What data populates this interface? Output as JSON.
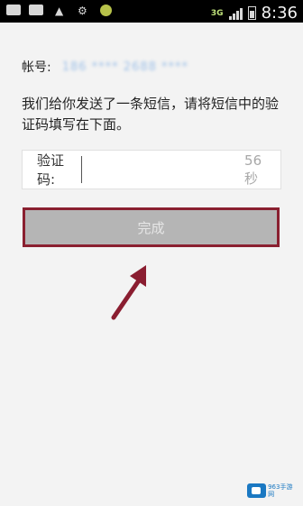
{
  "status_bar": {
    "time": "8:36",
    "network": "3G",
    "icons": [
      "download-icon",
      "usb-icon",
      "android-icon",
      "sync-icon",
      "notification-icon"
    ]
  },
  "account": {
    "label": "帐号:",
    "value": "186 **** 2688 ****"
  },
  "message": "我们给你发送了一条短信，请将短信中的验证码填写在下面。",
  "code_field": {
    "label": "验证码:",
    "value": "",
    "countdown": "56秒"
  },
  "done_button": {
    "label": "完成"
  },
  "colors": {
    "accent_border": "#8a2030",
    "button_bg": "#b5b5b5",
    "background": "#f3f3f3"
  },
  "watermark": {
    "text": "963手游网"
  }
}
